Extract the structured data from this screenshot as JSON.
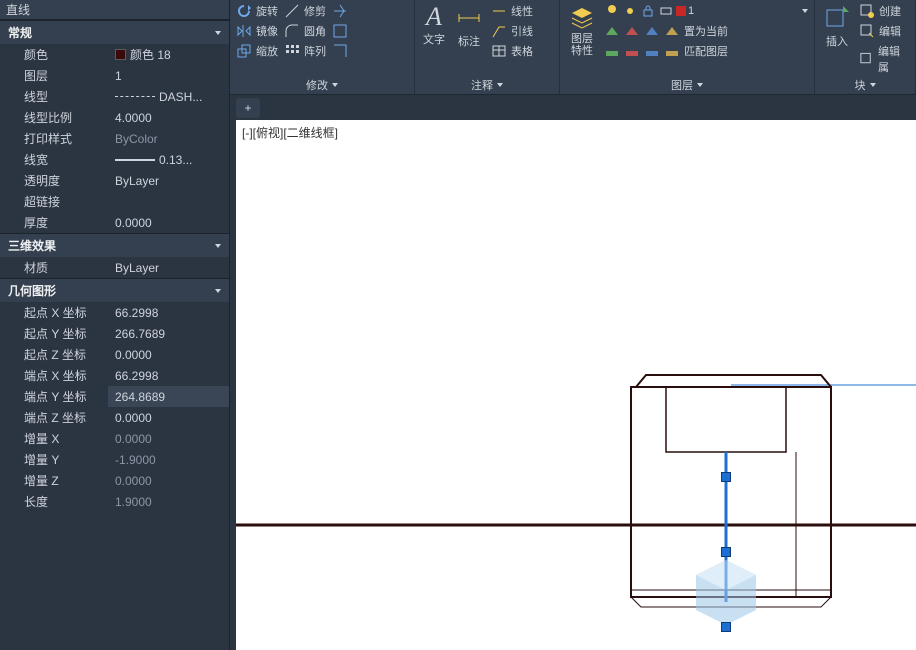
{
  "ribbon": {
    "panels": {
      "modify": {
        "label": "修改",
        "rotate": "旋转",
        "mirror": "镜像",
        "scale": "缩放",
        "trim": "修剪",
        "fillet": "圆角",
        "array": "阵列"
      },
      "annotate": {
        "label": "注释",
        "text": "文字",
        "dim": "标注",
        "linetype": "线性",
        "leader": "引线",
        "table": "表格"
      },
      "layers": {
        "label": "图层",
        "props": "图层\n特性",
        "current": "置为当前",
        "match": "匹配图层",
        "combo": "1"
      },
      "block": {
        "label": "块",
        "insert": "插入",
        "create": "创建",
        "edit": "编辑",
        "editattr": "编辑属"
      }
    }
  },
  "props": {
    "top": "直线",
    "g_general": "常规",
    "g_3d": "三维效果",
    "g_geom": "几何图形",
    "rows": {
      "color": {
        "name": "颜色",
        "value": "颜色 18"
      },
      "layer": {
        "name": "图层",
        "value": "1"
      },
      "linetype": {
        "name": "线型",
        "value": "DASH..."
      },
      "ltscale": {
        "name": "线型比例",
        "value": "4.0000"
      },
      "plotstyle": {
        "name": "打印样式",
        "value": "ByColor"
      },
      "lineweight": {
        "name": "线宽",
        "value": "0.13..."
      },
      "transp": {
        "name": "透明度",
        "value": "ByLayer"
      },
      "hyperlink": {
        "name": "超链接",
        "value": ""
      },
      "thickness": {
        "name": "厚度",
        "value": "0.0000"
      },
      "material": {
        "name": "材质",
        "value": "ByLayer"
      },
      "sx": {
        "name": "起点 X 坐标",
        "value": "66.2998"
      },
      "sy": {
        "name": "起点 Y 坐标",
        "value": "266.7689"
      },
      "sz": {
        "name": "起点 Z 坐标",
        "value": "0.0000"
      },
      "ex": {
        "name": "端点 X 坐标",
        "value": "66.2998"
      },
      "ey": {
        "name": "端点 Y 坐标",
        "value": "264.8689"
      },
      "ez": {
        "name": "端点 Z 坐标",
        "value": "0.0000"
      },
      "dx": {
        "name": "增量 X",
        "value": "0.0000"
      },
      "dy": {
        "name": "增量 Y",
        "value": "-1.9000"
      },
      "dz": {
        "name": "增量 Z",
        "value": "0.0000"
      },
      "len": {
        "name": "长度",
        "value": "1.9000"
      }
    }
  },
  "canvas": {
    "view_label": "[-][俯视][二维线框]",
    "plus": "+"
  },
  "colors": {
    "sel_blue": "#1d6fd4",
    "obj_stroke": "#2a0d0d"
  }
}
